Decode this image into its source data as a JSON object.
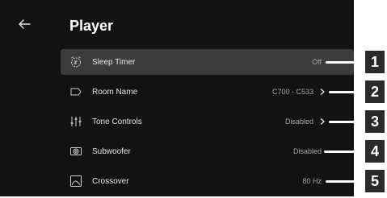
{
  "header": {
    "title": "Player",
    "back_icon": "arrow-left-icon"
  },
  "rows": [
    {
      "label": "Sleep Timer",
      "value": "Off",
      "icon": "sleep-timer-icon",
      "chevron": false,
      "selected": true
    },
    {
      "label": "Room Name",
      "value": "C700 - C533",
      "icon": "room-tag-icon",
      "chevron": true,
      "selected": false
    },
    {
      "label": "Tone Controls",
      "value": "Disabled",
      "icon": "sliders-icon",
      "chevron": true,
      "selected": false
    },
    {
      "label": "Subwoofer",
      "value": "Disabled",
      "icon": "subwoofer-icon",
      "chevron": false,
      "selected": false
    },
    {
      "label": "Crossover",
      "value": "80 Hz",
      "icon": "crossover-icon",
      "chevron": false,
      "selected": false
    }
  ],
  "callouts": [
    "1",
    "2",
    "3",
    "4",
    "5"
  ],
  "colors": {
    "screen_bg": "#121212",
    "selected_row_bg": "#3c3c3c",
    "badge_bg": "#2a2a2a",
    "text": "#e6e6e6",
    "value_text": "#a8a8a8"
  }
}
